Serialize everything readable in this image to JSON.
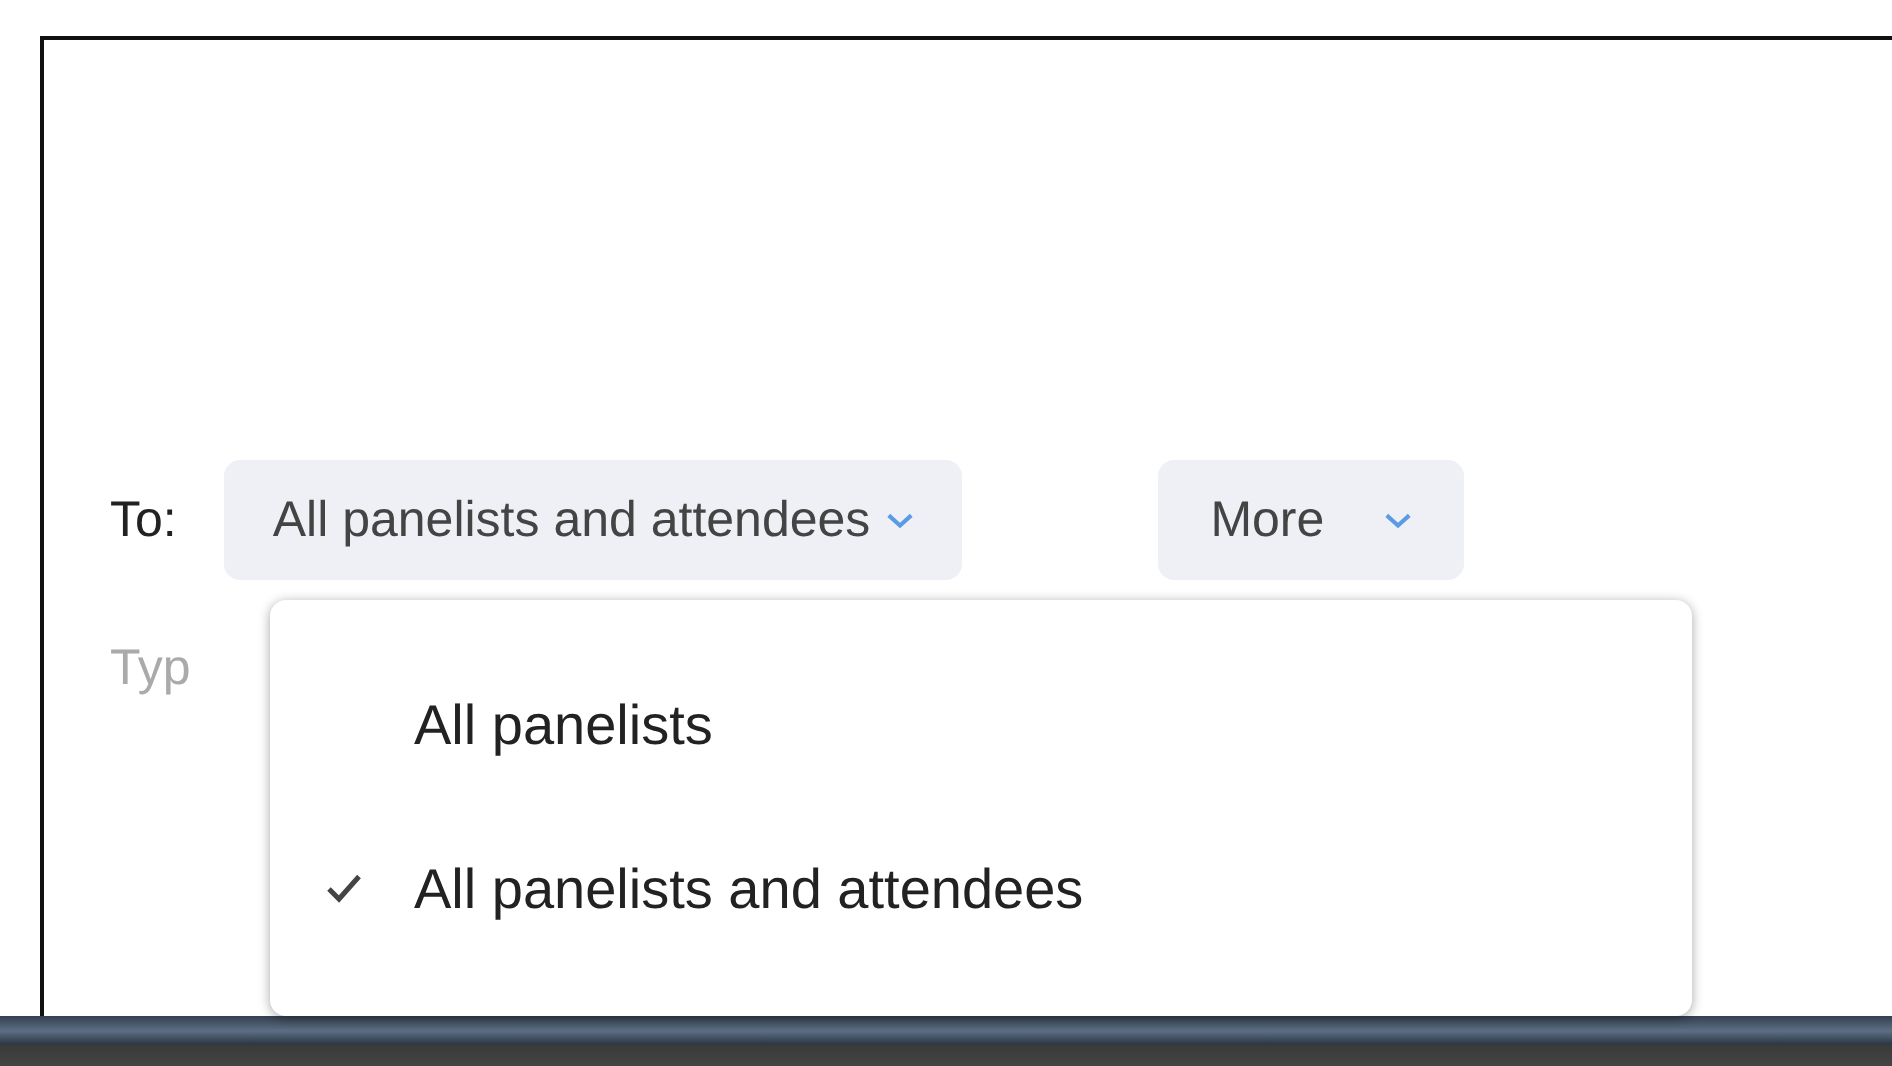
{
  "to_label": "To:",
  "recipient_dropdown": {
    "value": "All panelists and attendees",
    "expanded": true
  },
  "more_button": {
    "label": "More"
  },
  "message_field": {
    "placeholder": "Typ"
  },
  "recipient_menu": {
    "items": [
      {
        "label": "All panelists",
        "selected": false
      },
      {
        "label": "All panelists and attendees",
        "selected": true
      }
    ]
  }
}
